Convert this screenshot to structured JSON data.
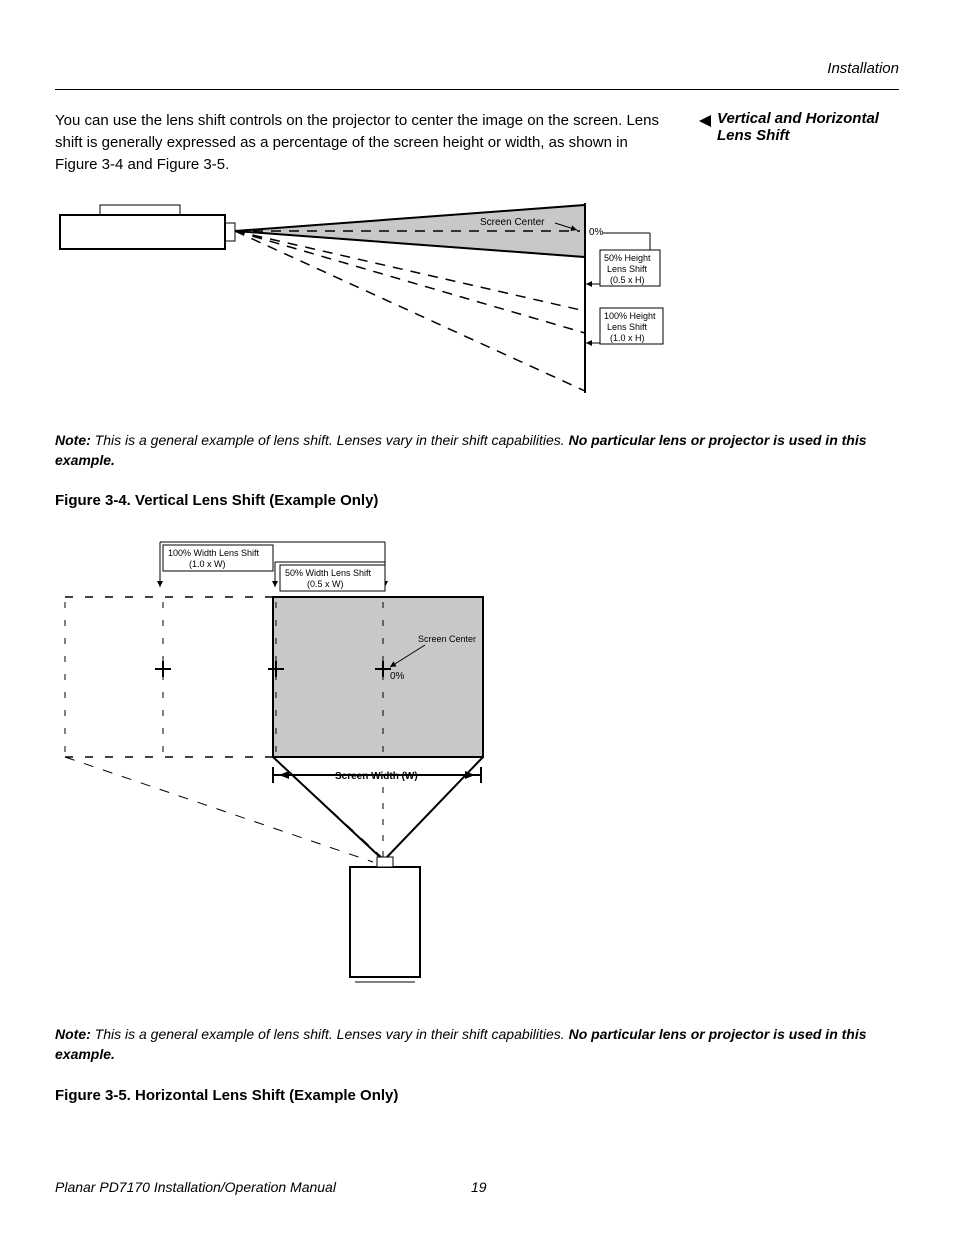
{
  "header": {
    "section": "Installation"
  },
  "sidecallout": {
    "line1": "Vertical and Horizontal",
    "line2": "Lens Shift"
  },
  "intro": "You can use the lens shift controls on the projector to center the image on the screen. Lens shift is generally expressed as a percentage of the screen height or width, as shown in Figure 3-4 and Figure 3-5.",
  "diagram1": {
    "screenCenter": "Screen Center",
    "zero": "0%",
    "shift50l1": "50% Height",
    "shift50l2": "Lens Shift",
    "shift50l3": "(0.5 x H)",
    "shift100l1": "100% Height",
    "shift100l2": "Lens Shift",
    "shift100l3": "(1.0 x H)"
  },
  "note1": {
    "label": "Note:",
    "text": " This is a general example of lens shift. Lenses vary in their shift capabilities. ",
    "bold": "No particular lens or projector is used in this example."
  },
  "caption1": "Figure 3-4. Vertical Lens Shift (Example Only)",
  "diagram2": {
    "shift100l1": "100% Width Lens Shift",
    "shift100l2": "(1.0 x W)",
    "shift50l1": "50% Width Lens Shift",
    "shift50l2": "(0.5 x W)",
    "screenCenter": "Screen Center",
    "zero": "0%",
    "screenWidth": "Screen Width (W)"
  },
  "note2": {
    "label": "Note:",
    "text": " This is a general example of lens shift. Lenses vary in their shift capabilities. ",
    "bold": "No particular lens or projector is used in this example."
  },
  "caption2": "Figure 3-5. Horizontal Lens Shift (Example Only)",
  "footer": {
    "title": "Planar PD7170 Installation/Operation Manual",
    "page": "19"
  }
}
